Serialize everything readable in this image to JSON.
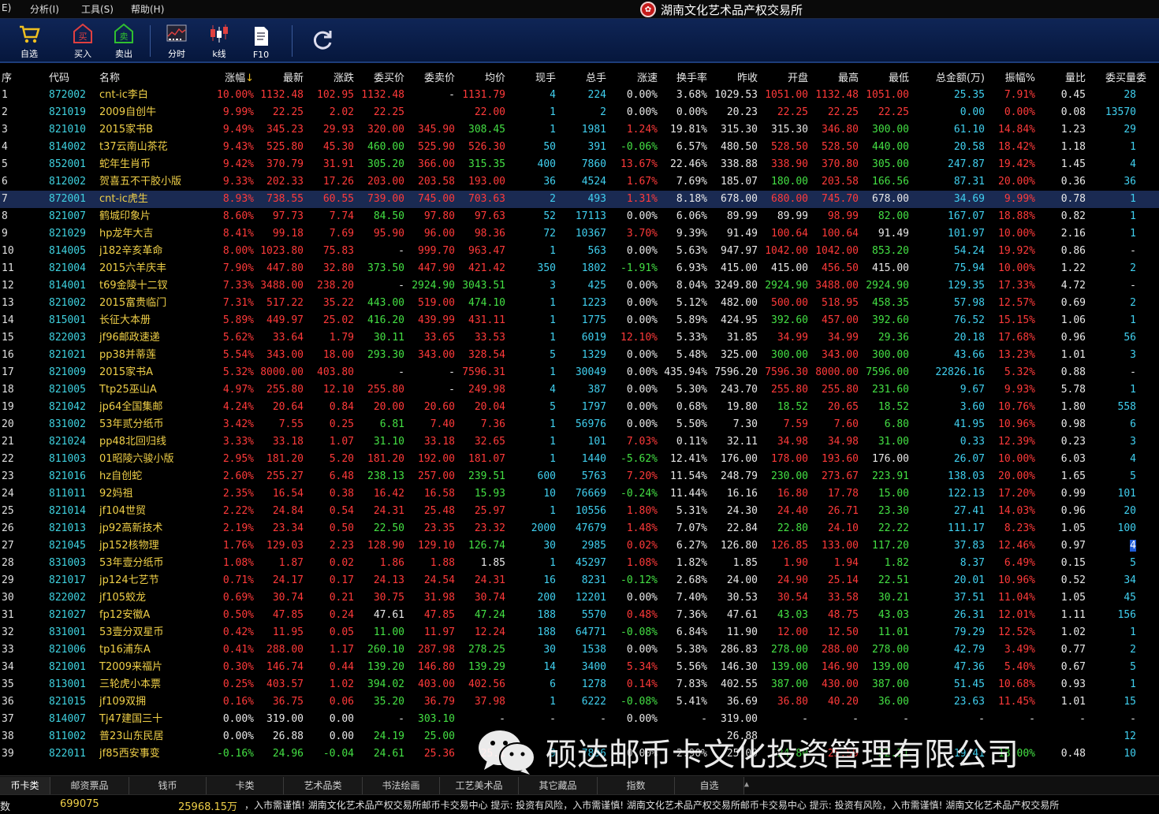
{
  "menu": [
    {
      "label": "E)"
    },
    {
      "label": "分析(I)"
    },
    {
      "label": "工具(S)"
    },
    {
      "label": "帮助(H)"
    }
  ],
  "app_title": "湖南文化艺术品产权交易所",
  "toolbar": [
    {
      "label": "自选",
      "icon": "cart-icon"
    },
    {
      "label": "买入",
      "icon": "buy-icon"
    },
    {
      "label": "卖出",
      "icon": "sell-icon"
    },
    {
      "label": "分时",
      "icon": "intraday-chart-icon"
    },
    {
      "label": "k线",
      "icon": "candlestick-icon"
    },
    {
      "label": "F10",
      "icon": "document-icon"
    },
    {
      "label": "",
      "icon": "refresh-icon"
    }
  ],
  "columns": [
    "序",
    "代码",
    "名称",
    "涨幅",
    "最新",
    "涨跌",
    "委买价",
    "委卖价",
    "均价",
    "现手",
    "总手",
    "涨速",
    "换手率",
    "昨收",
    "开盘",
    "最高",
    "最低",
    "总金额(万)",
    "振幅%",
    "量比",
    "委买量",
    "委"
  ],
  "sort_arrow": "↓",
  "rows": [
    [
      "1",
      "872002",
      "cnt-ic李白",
      "10.00%",
      "1132.48",
      "102.95",
      "1132.48",
      "-",
      "1131.79",
      "4",
      "224",
      "0.00%",
      "3.68%",
      "1029.53",
      "1051.00",
      "1132.48",
      "1051.00",
      "25.35",
      "7.91%",
      "0.45",
      "28"
    ],
    [
      "2",
      "821019",
      "2009自创牛",
      "9.99%",
      "22.25",
      "2.02",
      "22.25",
      "",
      "22.00",
      "1",
      "2",
      "0.00%",
      "0.00%",
      "20.23",
      "22.25",
      "22.25",
      "22.25",
      "0.00",
      "0.00%",
      "0.08",
      "13570"
    ],
    [
      "3",
      "821010",
      "2015家书B",
      "9.49%",
      "345.23",
      "29.93",
      "320.00",
      "345.90",
      "308.45",
      "1",
      "1981",
      "1.24%",
      "19.81%",
      "315.30",
      "315.30",
      "346.80",
      "300.00",
      "61.10",
      "14.84%",
      "1.23",
      "29"
    ],
    [
      "4",
      "814002",
      "t37云南山茶花",
      "9.43%",
      "525.80",
      "45.30",
      "460.00",
      "525.90",
      "526.30",
      "50",
      "391",
      "-0.06%",
      "6.57%",
      "480.50",
      "528.50",
      "528.50",
      "440.00",
      "20.58",
      "18.42%",
      "1.18",
      "1"
    ],
    [
      "5",
      "852001",
      "蛇年生肖币",
      "9.42%",
      "370.79",
      "31.91",
      "305.20",
      "366.00",
      "315.35",
      "400",
      "7860",
      "13.67%",
      "22.46%",
      "338.88",
      "338.90",
      "370.80",
      "305.00",
      "247.87",
      "19.42%",
      "1.45",
      "4"
    ],
    [
      "6",
      "812002",
      "贺喜五不干胶小版",
      "9.33%",
      "202.33",
      "17.26",
      "203.00",
      "203.58",
      "193.00",
      "36",
      "4524",
      "1.67%",
      "7.69%",
      "185.07",
      "180.00",
      "203.58",
      "166.56",
      "87.31",
      "20.00%",
      "0.36",
      "36"
    ],
    [
      "7",
      "872001",
      "cnt-ic虎生",
      "8.93%",
      "738.55",
      "60.55",
      "739.00",
      "745.00",
      "703.63",
      "2",
      "493",
      "1.31%",
      "8.18%",
      "678.00",
      "680.00",
      "745.70",
      "678.00",
      "34.69",
      "9.99%",
      "0.78",
      "1"
    ],
    [
      "8",
      "821007",
      "鹤城印象片",
      "8.60%",
      "97.73",
      "7.74",
      "84.50",
      "97.80",
      "97.63",
      "52",
      "17113",
      "0.00%",
      "6.06%",
      "89.99",
      "89.99",
      "98.99",
      "82.00",
      "167.07",
      "18.88%",
      "0.82",
      "1"
    ],
    [
      "9",
      "821029",
      "hp龙年大吉",
      "8.41%",
      "99.18",
      "7.69",
      "95.90",
      "96.00",
      "98.36",
      "72",
      "10367",
      "3.70%",
      "9.39%",
      "91.49",
      "100.64",
      "100.64",
      "91.49",
      "101.97",
      "10.00%",
      "2.16",
      "1"
    ],
    [
      "10",
      "814005",
      "j182辛亥革命",
      "8.00%",
      "1023.80",
      "75.83",
      "-",
      "999.70",
      "963.47",
      "1",
      "563",
      "0.00%",
      "5.63%",
      "947.97",
      "1042.00",
      "1042.00",
      "853.20",
      "54.24",
      "19.92%",
      "0.86",
      "-"
    ],
    [
      "11",
      "821004",
      "2015六羊庆丰",
      "7.90%",
      "447.80",
      "32.80",
      "373.50",
      "447.90",
      "421.42",
      "350",
      "1802",
      "-1.91%",
      "6.93%",
      "415.00",
      "415.00",
      "456.50",
      "415.00",
      "75.94",
      "10.00%",
      "1.22",
      "2"
    ],
    [
      "12",
      "814001",
      "t69金陵十二钗",
      "7.33%",
      "3488.00",
      "238.20",
      "-",
      "2924.90",
      "3043.51",
      "3",
      "425",
      "0.00%",
      "8.04%",
      "3249.80",
      "2924.90",
      "3488.00",
      "2924.90",
      "129.35",
      "17.33%",
      "4.72",
      "-"
    ],
    [
      "13",
      "821002",
      "2015富贵临门",
      "7.31%",
      "517.22",
      "35.22",
      "443.00",
      "519.00",
      "474.10",
      "1",
      "1223",
      "0.00%",
      "5.12%",
      "482.00",
      "500.00",
      "518.95",
      "458.35",
      "57.98",
      "12.57%",
      "0.69",
      "2"
    ],
    [
      "14",
      "815001",
      "长征大本册",
      "5.89%",
      "449.97",
      "25.02",
      "416.20",
      "439.99",
      "431.11",
      "1",
      "1775",
      "0.00%",
      "5.89%",
      "424.95",
      "392.60",
      "457.00",
      "392.60",
      "76.52",
      "15.15%",
      "1.06",
      "1"
    ],
    [
      "15",
      "822003",
      "jf96邮政速递",
      "5.62%",
      "33.64",
      "1.79",
      "30.11",
      "33.65",
      "33.53",
      "1",
      "6019",
      "12.10%",
      "5.33%",
      "31.85",
      "34.99",
      "34.99",
      "29.36",
      "20.18",
      "17.68%",
      "0.96",
      "56"
    ],
    [
      "16",
      "821021",
      "pp38并蒂莲",
      "5.54%",
      "343.00",
      "18.00",
      "293.30",
      "343.00",
      "328.54",
      "5",
      "1329",
      "0.00%",
      "5.48%",
      "325.00",
      "300.00",
      "343.00",
      "300.00",
      "43.66",
      "13.23%",
      "1.01",
      "3"
    ],
    [
      "17",
      "821009",
      "2015家书A",
      "5.32%",
      "8000.00",
      "403.80",
      "-",
      "-",
      "7596.31",
      "1",
      "30049",
      "0.00%",
      "435.94%",
      "7596.20",
      "7596.30",
      "8000.00",
      "7596.00",
      "22826.16",
      "5.32%",
      "0.88",
      "-"
    ],
    [
      "18",
      "821005",
      "Ttp25巫山A",
      "4.97%",
      "255.80",
      "12.10",
      "255.80",
      "-",
      "249.98",
      "4",
      "387",
      "0.00%",
      "5.30%",
      "243.70",
      "255.80",
      "255.80",
      "231.60",
      "9.67",
      "9.93%",
      "5.78",
      "1"
    ],
    [
      "19",
      "821042",
      "jp64全国集邮",
      "4.24%",
      "20.64",
      "0.84",
      "20.00",
      "20.60",
      "20.04",
      "5",
      "1797",
      "0.00%",
      "0.68%",
      "19.80",
      "18.52",
      "20.65",
      "18.52",
      "3.60",
      "10.76%",
      "1.80",
      "558"
    ],
    [
      "20",
      "831002",
      "53年贰分纸币",
      "3.42%",
      "7.55",
      "0.25",
      "6.81",
      "7.40",
      "7.36",
      "1",
      "56976",
      "0.00%",
      "5.50%",
      "7.30",
      "7.59",
      "7.60",
      "6.80",
      "41.95",
      "10.96%",
      "0.98",
      "6"
    ],
    [
      "21",
      "821024",
      "pp48北回归线",
      "3.33%",
      "33.18",
      "1.07",
      "31.10",
      "33.18",
      "32.65",
      "1",
      "101",
      "7.03%",
      "0.11%",
      "32.11",
      "34.98",
      "34.98",
      "31.00",
      "0.33",
      "12.39%",
      "0.23",
      "3"
    ],
    [
      "22",
      "811003",
      "01昭陵六骏小版",
      "2.95%",
      "181.20",
      "5.20",
      "181.20",
      "192.00",
      "181.07",
      "1",
      "1440",
      "-5.62%",
      "12.41%",
      "176.00",
      "178.00",
      "193.60",
      "176.00",
      "26.07",
      "10.00%",
      "6.03",
      "4"
    ],
    [
      "23",
      "821016",
      "hz自创蛇",
      "2.60%",
      "255.27",
      "6.48",
      "238.13",
      "257.00",
      "239.51",
      "600",
      "5763",
      "7.20%",
      "11.54%",
      "248.79",
      "230.00",
      "273.67",
      "223.91",
      "138.03",
      "20.00%",
      "1.65",
      "5"
    ],
    [
      "24",
      "811011",
      "92妈祖",
      "2.35%",
      "16.54",
      "0.38",
      "16.42",
      "16.58",
      "15.93",
      "10",
      "76669",
      "-0.24%",
      "11.44%",
      "16.16",
      "16.80",
      "17.78",
      "15.00",
      "122.13",
      "17.20%",
      "0.99",
      "101"
    ],
    [
      "25",
      "821014",
      "jf104世贸",
      "2.22%",
      "24.84",
      "0.54",
      "24.31",
      "25.48",
      "25.97",
      "1",
      "10556",
      "1.80%",
      "5.31%",
      "24.30",
      "24.40",
      "26.71",
      "23.30",
      "27.41",
      "14.03%",
      "0.96",
      "20"
    ],
    [
      "26",
      "821013",
      "jp92高新技术",
      "2.19%",
      "23.34",
      "0.50",
      "22.50",
      "23.35",
      "23.32",
      "2000",
      "47679",
      "1.48%",
      "7.07%",
      "22.84",
      "22.80",
      "24.10",
      "22.22",
      "111.17",
      "8.23%",
      "1.05",
      "100"
    ],
    [
      "27",
      "821045",
      "jp152核物理",
      "1.76%",
      "129.03",
      "2.23",
      "128.90",
      "129.10",
      "126.74",
      "30",
      "2985",
      "0.02%",
      "6.27%",
      "126.80",
      "126.85",
      "133.00",
      "117.20",
      "37.83",
      "12.46%",
      "0.97",
      "4"
    ],
    [
      "28",
      "831003",
      "53年壹分纸币",
      "1.08%",
      "1.87",
      "0.02",
      "1.86",
      "1.88",
      "1.85",
      "1",
      "45297",
      "1.08%",
      "1.82%",
      "1.85",
      "1.90",
      "1.94",
      "1.82",
      "8.37",
      "6.49%",
      "0.15",
      "5"
    ],
    [
      "29",
      "821017",
      "jp124七艺节",
      "0.71%",
      "24.17",
      "0.17",
      "24.13",
      "24.54",
      "24.31",
      "16",
      "8231",
      "-0.12%",
      "2.68%",
      "24.00",
      "24.90",
      "25.14",
      "22.51",
      "20.01",
      "10.96%",
      "0.52",
      "34"
    ],
    [
      "30",
      "822002",
      "jf105蛟龙",
      "0.69%",
      "30.74",
      "0.21",
      "30.75",
      "31.98",
      "30.74",
      "200",
      "12201",
      "0.00%",
      "7.40%",
      "30.53",
      "30.54",
      "33.58",
      "30.21",
      "37.51",
      "11.04%",
      "1.05",
      "45"
    ],
    [
      "31",
      "821027",
      "fp12安徽A",
      "0.50%",
      "47.85",
      "0.24",
      "47.61",
      "47.85",
      "47.24",
      "188",
      "5570",
      "0.48%",
      "7.36%",
      "47.61",
      "43.03",
      "48.75",
      "43.03",
      "26.31",
      "12.01%",
      "1.11",
      "156"
    ],
    [
      "32",
      "831001",
      "53壹分双星币",
      "0.42%",
      "11.95",
      "0.05",
      "11.00",
      "11.97",
      "12.24",
      "188",
      "64771",
      "-0.08%",
      "6.84%",
      "11.90",
      "12.00",
      "12.50",
      "11.01",
      "79.29",
      "12.52%",
      "1.02",
      "1"
    ],
    [
      "33",
      "821006",
      "tp16浦东A",
      "0.41%",
      "288.00",
      "1.17",
      "260.10",
      "287.98",
      "278.25",
      "30",
      "1538",
      "0.00%",
      "5.38%",
      "286.83",
      "278.00",
      "288.00",
      "278.00",
      "42.79",
      "3.49%",
      "0.77",
      "2"
    ],
    [
      "34",
      "821001",
      "T2009来福片",
      "0.30%",
      "146.74",
      "0.44",
      "139.20",
      "146.80",
      "139.29",
      "14",
      "3400",
      "5.34%",
      "5.56%",
      "146.30",
      "139.00",
      "146.90",
      "139.00",
      "47.36",
      "5.40%",
      "0.67",
      "5"
    ],
    [
      "35",
      "813001",
      "三轮虎小本票",
      "0.25%",
      "403.57",
      "1.02",
      "394.02",
      "403.00",
      "402.56",
      "6",
      "1278",
      "0.14%",
      "7.83%",
      "402.55",
      "387.00",
      "430.00",
      "387.00",
      "51.45",
      "10.68%",
      "0.93",
      "1"
    ],
    [
      "36",
      "821015",
      "jf109双拥",
      "0.16%",
      "36.75",
      "0.06",
      "35.20",
      "36.79",
      "37.98",
      "1",
      "6222",
      "-0.08%",
      "5.41%",
      "36.69",
      "36.80",
      "40.20",
      "36.00",
      "23.63",
      "11.45%",
      "1.01",
      "15"
    ],
    [
      "37",
      "814007",
      "Tj47建国三十",
      "0.00%",
      "319.00",
      "0.00",
      "-",
      "303.10",
      "-",
      "-",
      "-",
      "0.00%",
      "-",
      "319.00",
      "-",
      "-",
      "-",
      "-",
      "-",
      "-",
      "-"
    ],
    [
      "38",
      "811002",
      "普23山东民居",
      "0.00%",
      "26.88",
      "0.00",
      "24.19",
      "25.00",
      "",
      "",
      "",
      "",
      "",
      "26.88",
      "",
      "",
      "",
      "",
      "",
      "",
      "12"
    ],
    [
      "39",
      "822011",
      "jf85西安事变",
      "-0.16%",
      "24.96",
      "-0.04",
      "24.61",
      "25.36",
      "25.1",
      "9",
      "7896",
      "0.00%",
      "2.90%",
      "25.00",
      "24.80",
      "25.59",
      "22.31",
      "19.41",
      "13.00%",
      "0.48",
      "10"
    ]
  ],
  "selected_row": 6,
  "watermark": "硕达邮币卡文化投资管理有限公司",
  "tabs": [
    "币卡类",
    "邮资票品",
    "钱币",
    "卡类",
    "艺术品类",
    "书法绘画",
    "工艺美术品",
    "其它藏品",
    "指数",
    "自选"
  ],
  "status": {
    "label": "数",
    "value1": "699075",
    "value2": "25968.15万",
    "ticker": "，入市需谨慎!     湖南文化艺术品产权交易所邮币卡交易中心  提示:  投资有风险，入市需谨慎!     湖南文化艺术品产权交易所邮币卡交易中心  提示:  投资有风险，入市需谨慎!     湖南文化艺术品产权交易所"
  },
  "colors": {
    "up": "#ff3a3a",
    "down": "#44e044",
    "code": "#3fd2e0",
    "name": "#f0d048",
    "volume": "#40d0f0",
    "selected": "#1a2a52"
  }
}
